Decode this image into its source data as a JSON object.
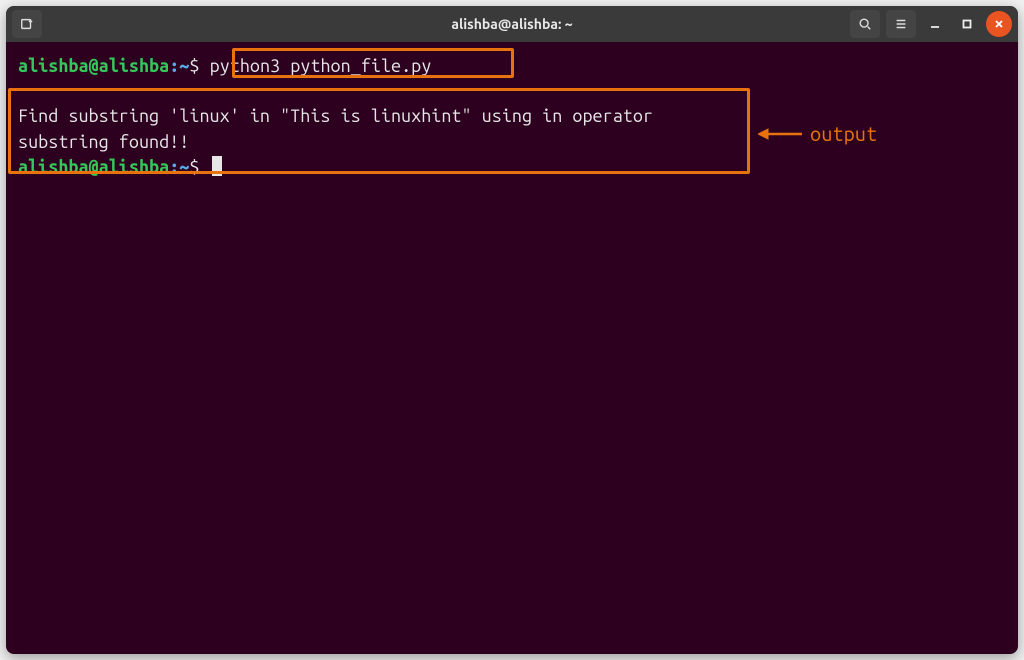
{
  "titlebar": {
    "title": "alishba@alishba: ~"
  },
  "prompt": {
    "user_host": "alishba@alishba",
    "separator": ":",
    "path": "~",
    "symbol": "$"
  },
  "command": "python3 python_file.py",
  "output": {
    "line1": "Find substring 'linux' in \"This is linuxhint\" using in operator",
    "line2": "",
    "line3": "substring found!!"
  },
  "annotation": {
    "label": "output"
  },
  "colors": {
    "accent": "#e8730e",
    "prompt_user": "#34c759",
    "prompt_path": "#5aa9e6",
    "terminal_bg": "#2c001e",
    "close_btn": "#e95420"
  }
}
